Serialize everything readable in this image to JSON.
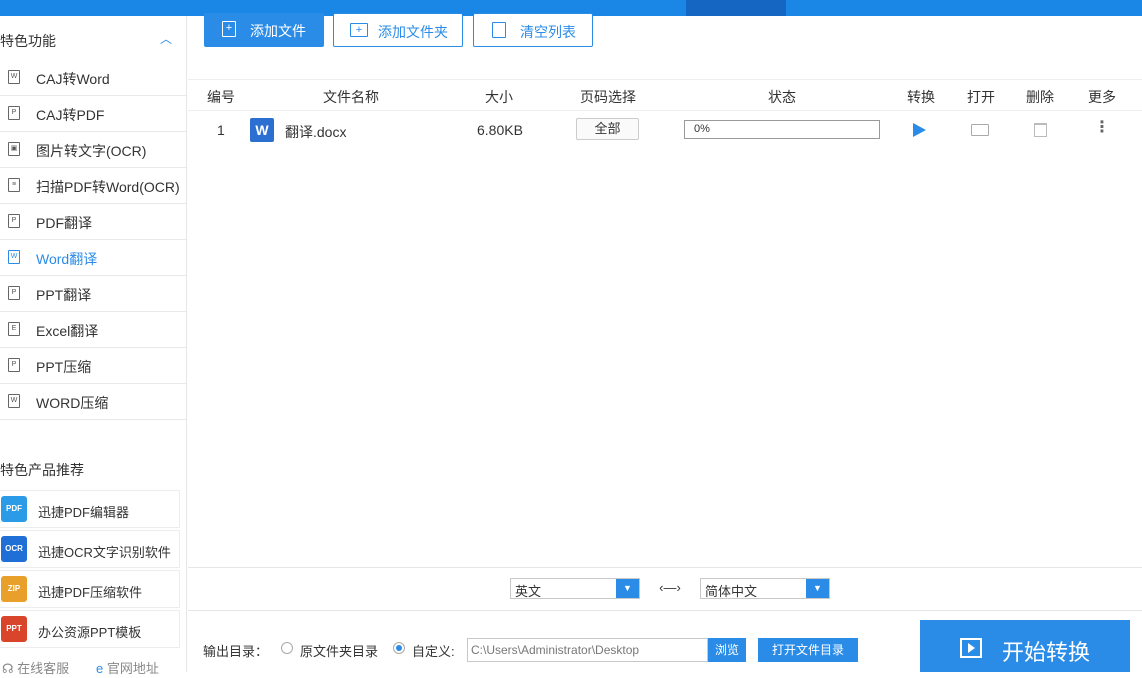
{
  "colors": {
    "accent": "#2b8ce8",
    "topbar": "#1a87e6"
  },
  "sidebar": {
    "section1_title": "特色功能",
    "collapse_icon": "chevron-up-icon",
    "items": [
      {
        "label": "CAJ转Word",
        "icon": "W"
      },
      {
        "label": "CAJ转PDF",
        "icon": "P"
      },
      {
        "label": "图片转文字(OCR)",
        "icon": "▣"
      },
      {
        "label": "扫描PDF转Word(OCR)",
        "icon": "≡"
      },
      {
        "label": "PDF翻译",
        "icon": "P"
      },
      {
        "label": "Word翻译",
        "icon": "W",
        "active": true
      },
      {
        "label": "PPT翻译",
        "icon": "P"
      },
      {
        "label": "Excel翻译",
        "icon": "E"
      },
      {
        "label": "PPT压缩",
        "icon": "P"
      },
      {
        "label": "WORD压缩",
        "icon": "W"
      }
    ],
    "section2_title": "特色产品推荐",
    "products": [
      {
        "label": "迅捷PDF编辑器",
        "icon_text": "PDF"
      },
      {
        "label": "迅捷OCR文字识别软件",
        "icon_text": "OCR"
      },
      {
        "label": "迅捷PDF压缩软件",
        "icon_text": "ZIP"
      },
      {
        "label": "办公资源PPT模板",
        "icon_text": "PPT"
      }
    ],
    "footer": {
      "service": "在线客服",
      "website": "官网地址"
    }
  },
  "toolbar": {
    "add_file": "添加文件",
    "add_folder": "添加文件夹",
    "clear_list": "清空列表"
  },
  "table": {
    "headers": {
      "index": "编号",
      "name": "文件名称",
      "size": "大小",
      "pages": "页码选择",
      "status": "状态",
      "convert": "转换",
      "open": "打开",
      "delete": "删除",
      "more": "更多"
    },
    "rows": [
      {
        "index": "1",
        "name": "翻译.docx",
        "size": "6.80KB",
        "pages": "全部",
        "progress": 0,
        "progress_text": "0%"
      }
    ]
  },
  "language": {
    "source": "英文",
    "target": "简体中文",
    "swap_text": "‹—›"
  },
  "output": {
    "label": "输出目录：",
    "option_original": "原文件夹目录",
    "option_custom": "自定义:",
    "path": "C:\\Users\\Administrator\\Desktop",
    "browse": "浏览",
    "open_dir": "打开文件目录"
  },
  "start_button": "开始转换"
}
